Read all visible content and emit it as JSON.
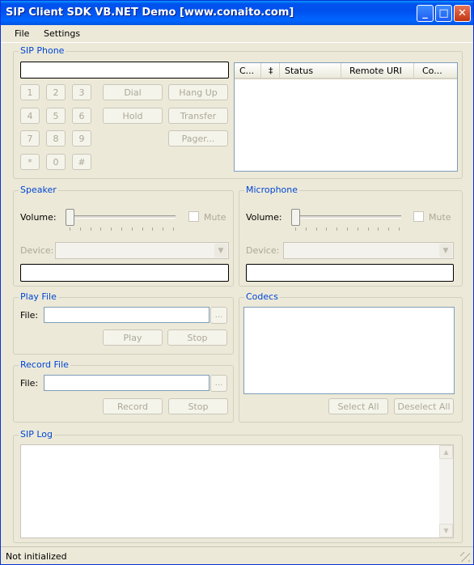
{
  "window": {
    "title": "SIP Client SDK VB.NET Demo [www.conaito.com]",
    "controls": {
      "minimize": "_",
      "maximize": "□",
      "close": "✕"
    }
  },
  "menu": {
    "items": [
      "File",
      "Settings"
    ]
  },
  "sip_phone": {
    "label": "SIP Phone",
    "number_value": "",
    "keypad": [
      "1",
      "2",
      "3",
      "4",
      "5",
      "6",
      "7",
      "8",
      "9",
      "*",
      "0",
      "#"
    ],
    "buttons": {
      "dial": "Dial",
      "hang_up": "Hang Up",
      "hold": "Hold",
      "transfer": "Transfer",
      "pager": "Pager..."
    },
    "calls_table": {
      "columns": [
        "C...",
        "‡",
        "Status",
        "Remote URI",
        "Co..."
      ],
      "rows": []
    }
  },
  "speaker": {
    "label": "Speaker",
    "volume_label": "Volume:",
    "volume_level": 0,
    "mute_label": "Mute",
    "device_label": "Device:",
    "device_value": "",
    "info_value": ""
  },
  "microphone": {
    "label": "Microphone",
    "volume_label": "Volume:",
    "volume_level": 0,
    "mute_label": "Mute",
    "device_label": "Device:",
    "device_value": "",
    "info_value": ""
  },
  "play_file": {
    "label": "Play File",
    "file_label": "File:",
    "file_value": "",
    "browse_label": "...",
    "play_label": "Play",
    "stop_label": "Stop"
  },
  "record_file": {
    "label": "Record File",
    "file_label": "File:",
    "file_value": "",
    "browse_label": "...",
    "record_label": "Record",
    "stop_label": "Stop"
  },
  "codecs": {
    "label": "Codecs",
    "items": [],
    "select_all_label": "Select All",
    "deselect_all_label": "Deselect All"
  },
  "sip_log": {
    "label": "SIP Log",
    "content": ""
  },
  "status": {
    "text": "Not initialized"
  },
  "colors": {
    "title_bar": "#0058ee",
    "group_label": "#0046d5",
    "disabled_text": "#aca899",
    "window_bg": "#ece9d8"
  }
}
